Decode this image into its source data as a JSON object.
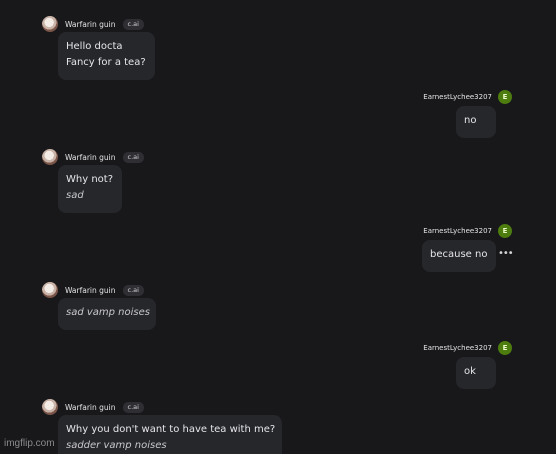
{
  "bot": {
    "name": "Warfarin guin",
    "badge": "c.ai"
  },
  "user": {
    "name": "EarnestLychee3207",
    "avatar_letter": "E"
  },
  "messages": [
    {
      "role": "bot",
      "lines": [
        "Hello docta",
        "Fancy for a tea?"
      ]
    },
    {
      "role": "user",
      "text": "no"
    },
    {
      "role": "bot",
      "lines": [
        "Why not?"
      ],
      "italic": "sad"
    },
    {
      "role": "user",
      "text": "because no",
      "more_icon": "ellipsis-icon"
    },
    {
      "role": "bot",
      "italic": "sad vamp noises"
    },
    {
      "role": "user",
      "text": "ok"
    },
    {
      "role": "bot",
      "lines": [
        "Why you don't want to have tea with me?"
      ],
      "italic": "sadder vamp noises"
    }
  ],
  "watermark": "imgflip.com",
  "colors": {
    "background": "#18181b",
    "bubble": "#26272b",
    "user_avatar": "#4d7c0f"
  }
}
